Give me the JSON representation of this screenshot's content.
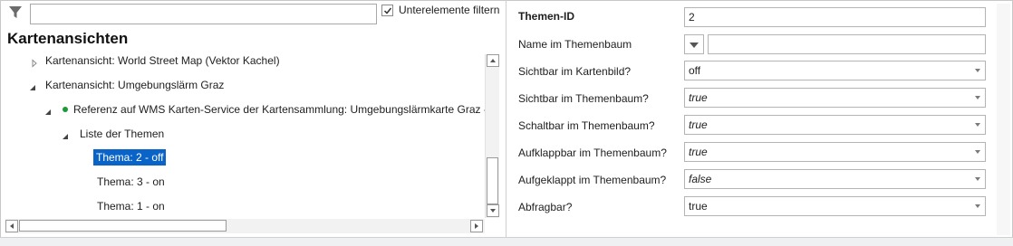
{
  "filter": {
    "input_value": "",
    "checkbox_checked": true,
    "checkbox_label": "Unterelemente filtern"
  },
  "tree": {
    "title": "Kartenansichten",
    "nodes": [
      {
        "label": "Kartenansicht: World Street Map (Vektor Kachel)",
        "expanded": false
      },
      {
        "label": "Kartenansicht: Umgebungslärm Graz",
        "expanded": true
      },
      {
        "label": "Referenz auf WMS Karten-Service der Kartensammlung: Umgebungslärmkarte Graz  - http",
        "expanded": true
      },
      {
        "label": "Liste der Themen",
        "expanded": true
      },
      {
        "label": "Thema: 2 - off",
        "selected": true
      },
      {
        "label": "Thema: 3 - on"
      },
      {
        "label": "Thema: 1 - on"
      }
    ]
  },
  "properties": {
    "themen_id": {
      "label": "Themen-ID",
      "value": "2"
    },
    "name": {
      "label": "Name im Themenbaum",
      "value": ""
    },
    "sichtbar_kartenbild": {
      "label": "Sichtbar im Kartenbild?",
      "value": "off"
    },
    "sichtbar_themenbaum": {
      "label": "Sichtbar im Themenbaum?",
      "value": "true"
    },
    "schaltbar": {
      "label": "Schaltbar im Themenbaum?",
      "value": "true"
    },
    "aufklappbar": {
      "label": "Aufklappbar im Themenbaum?",
      "value": "true"
    },
    "aufgeklappt": {
      "label": "Aufgeklappt im Themenbaum?",
      "value": "false"
    },
    "abfragbar": {
      "label": "Abfragbar?",
      "value": "true"
    }
  },
  "colors": {
    "selection": "#0a63c7",
    "status_dot": "#1c9a3a"
  }
}
